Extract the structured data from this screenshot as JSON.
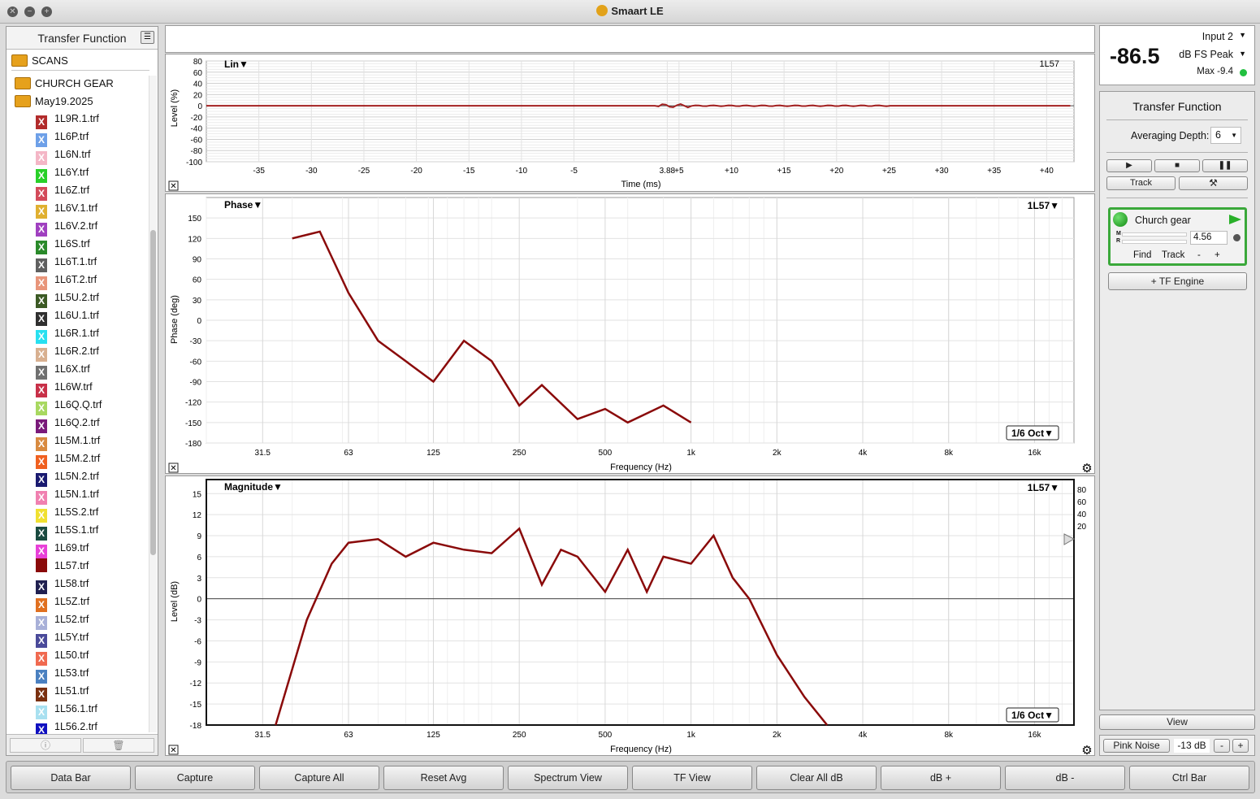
{
  "window": {
    "title": "Smaart LE"
  },
  "sidebar": {
    "title": "Transfer Function",
    "scans_label": "SCANS",
    "folders": [
      "CHURCH GEAR",
      "May19.2025"
    ],
    "files": [
      {
        "name": "1L9R.1.trf",
        "color": "#b22b2b"
      },
      {
        "name": "1L6P.trf",
        "color": "#6ea0e8"
      },
      {
        "name": "1L6N.trf",
        "color": "#f4b6c6"
      },
      {
        "name": "1L6Y.trf",
        "color": "#28d028"
      },
      {
        "name": "1L6Z.trf",
        "color": "#d34a5a"
      },
      {
        "name": "1L6V.1.trf",
        "color": "#e0b030"
      },
      {
        "name": "1L6V.2.trf",
        "color": "#a040c0"
      },
      {
        "name": "1L6S.trf",
        "color": "#2a8a2a"
      },
      {
        "name": "1L6T.1.trf",
        "color": "#606060"
      },
      {
        "name": "1L6T.2.trf",
        "color": "#e8957a"
      },
      {
        "name": "1L5U.2.trf",
        "color": "#3c5a24"
      },
      {
        "name": "1L6U.1.trf",
        "color": "#303030"
      },
      {
        "name": "1L6R.1.trf",
        "color": "#28e0f0"
      },
      {
        "name": "1L6R.2.trf",
        "color": "#d8b090"
      },
      {
        "name": "1L6X.trf",
        "color": "#707070"
      },
      {
        "name": "1L6W.trf",
        "color": "#c83048"
      },
      {
        "name": "1L6Q.Q.trf",
        "color": "#a8d860"
      },
      {
        "name": "1L6Q.2.trf",
        "color": "#7a1a7a"
      },
      {
        "name": "1L5M.1.trf",
        "color": "#d88a40"
      },
      {
        "name": "1L5M.2.trf",
        "color": "#f06020"
      },
      {
        "name": "1L5N.2.trf",
        "color": "#1a1a70"
      },
      {
        "name": "1L5N.1.trf",
        "color": "#f080b0"
      },
      {
        "name": "1L5S.2.trf",
        "color": "#f0e030"
      },
      {
        "name": "1L5S.1.trf",
        "color": "#1a4a40"
      },
      {
        "name": "1L69.trf",
        "color": "#e840d8"
      },
      {
        "name": "1L57.trf",
        "color": "#8a0a0a"
      },
      {
        "name": "1L58.trf",
        "color": "#202050"
      },
      {
        "name": "1L5Z.trf",
        "color": "#e07020"
      },
      {
        "name": "1L52.trf",
        "color": "#a8b0d8"
      },
      {
        "name": "1L5Y.trf",
        "color": "#4a4a9a"
      },
      {
        "name": "1L50.trf",
        "color": "#f06a50"
      },
      {
        "name": "1L53.trf",
        "color": "#4a80c0"
      },
      {
        "name": "1L51.trf",
        "color": "#7a3010"
      },
      {
        "name": "1L56.1.trf",
        "color": "#a8e0f0"
      },
      {
        "name": "1L56.2.trf",
        "color": "#1010c0"
      }
    ],
    "foot_info_icon": "info-icon",
    "foot_trash_icon": "trash-icon"
  },
  "meter": {
    "value": "-86.5",
    "input": "Input 2",
    "unit": "dB FS Peak",
    "max": "Max -9.4"
  },
  "control": {
    "title": "Transfer Function",
    "avg_label": "Averaging Depth:",
    "avg_value": "6",
    "track_label": "Track",
    "engine": {
      "name": "Church gear",
      "value": "4.56",
      "m_label": "M",
      "r_label": "R",
      "find": "Find",
      "track": "Track",
      "minus": "-",
      "plus": "+"
    },
    "add_engine": "+ TF Engine",
    "view_label": "View",
    "pink_noise": "Pink Noise",
    "pink_level": "-13 dB",
    "pink_minus": "-",
    "pink_plus": "+"
  },
  "impulse": {
    "mode": "Lin▼",
    "trace": "1L57",
    "ylabel": "Level (%)",
    "xlabel": "Time (ms)",
    "yticks": [
      "80",
      "60",
      "40",
      "20",
      "0",
      "-20",
      "-40",
      "-60",
      "-80",
      "-100"
    ],
    "xticks": [
      "-35",
      "-30",
      "-25",
      "-20",
      "-15",
      "-10",
      "-5",
      "3.88",
      "+5",
      "+10",
      "+15",
      "+20",
      "+25",
      "+30",
      "+35",
      "+40"
    ]
  },
  "phase": {
    "mode": "Phase▼",
    "trace": "1L57▼",
    "ylabel": "Phase (deg)",
    "xlabel": "Frequency (Hz)",
    "smoothing": "1/6 Oct▼",
    "yticks": [
      "150",
      "120",
      "90",
      "60",
      "30",
      "0",
      "-30",
      "-60",
      "-90",
      "-120",
      "-150",
      "-180"
    ],
    "xticks": [
      "31.5",
      "63",
      "125",
      "250",
      "500",
      "1k",
      "2k",
      "4k",
      "8k",
      "16k"
    ]
  },
  "magnitude": {
    "mode": "Magnitude▼",
    "trace": "1L57▼",
    "ylabel": "Level (dB)",
    "xlabel": "Frequency (Hz)",
    "smoothing": "1/6 Oct▼",
    "yticks": [
      "15",
      "12",
      "9",
      "6",
      "3",
      "0",
      "-3",
      "-6",
      "-9",
      "-12",
      "-15",
      "-18"
    ],
    "rticks": [
      "80",
      "60",
      "40",
      "20"
    ],
    "xticks": [
      "31.5",
      "63",
      "125",
      "250",
      "500",
      "1k",
      "2k",
      "4k",
      "8k",
      "16k"
    ]
  },
  "chart_data": [
    {
      "type": "line",
      "ylabel": "Level (%)",
      "xlabel": "Time (ms)",
      "ylim": [
        -100,
        80
      ],
      "series": [
        {
          "name": "1L57",
          "x": [
            -35,
            3,
            3.88,
            5,
            10,
            40
          ],
          "y": [
            0,
            0,
            4,
            -1,
            1,
            0
          ]
        }
      ]
    },
    {
      "type": "line",
      "ylabel": "Phase (deg)",
      "xlabel": "Frequency (Hz)",
      "ylim": [
        -180,
        180
      ],
      "series": [
        {
          "name": "1L57",
          "x": [
            40,
            50,
            63,
            80,
            100,
            125,
            160,
            200,
            250,
            300,
            400,
            500,
            600,
            800,
            1000
          ],
          "y": [
            120,
            130,
            40,
            -30,
            -60,
            -90,
            -30,
            -60,
            -125,
            -95,
            -145,
            -130,
            -150,
            -125,
            -150
          ]
        }
      ]
    },
    {
      "type": "line",
      "ylabel": "Level (dB)",
      "xlabel": "Frequency (Hz)",
      "ylim": [
        -18,
        15
      ],
      "series": [
        {
          "name": "1L57",
          "x": [
            35,
            45,
            55,
            63,
            80,
            100,
            125,
            160,
            200,
            250,
            300,
            350,
            400,
            500,
            600,
            700,
            800,
            1000,
            1200,
            1400,
            1600,
            2000,
            2500,
            3000
          ],
          "y": [
            -18,
            -3,
            5,
            8,
            8.5,
            6,
            8,
            7,
            6.5,
            10,
            2,
            7,
            6,
            1,
            7,
            1,
            6,
            5,
            9,
            3,
            0,
            -8,
            -14,
            -18
          ]
        }
      ]
    }
  ]
}
